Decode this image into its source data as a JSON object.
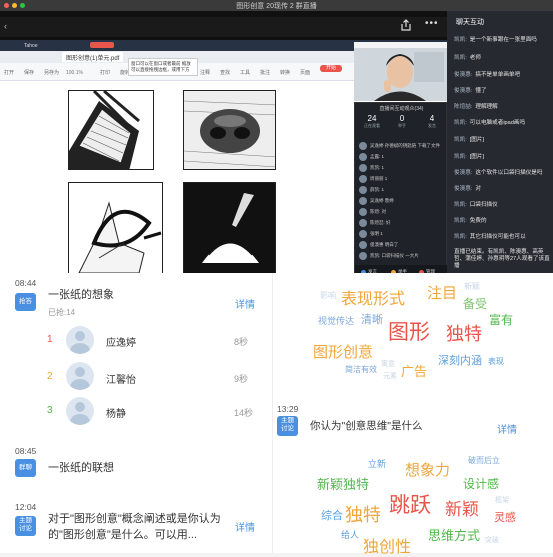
{
  "window": {
    "title": "图形创意 20现传 2 群直播"
  },
  "chat": {
    "title": "聊天互动",
    "messages": [
      {
        "name": "凯凯:",
        "text": "是一个新事跟在一张里面吗"
      },
      {
        "name": "凯凯:",
        "text": "老师"
      },
      {
        "name": "俊澳惠:",
        "text": "搞不是单单画单吧"
      },
      {
        "name": "俊澳惠:",
        "text": "懂了"
      },
      {
        "name": "陈煊喆:",
        "text": "理解理解"
      },
      {
        "name": "凯凯:",
        "text": "可以电脑或者ipad画吗"
      },
      {
        "name": "凯凯:",
        "text": "[图片]"
      },
      {
        "name": "凯凯:",
        "text": "[图片]"
      },
      {
        "name": "俊澳惠:",
        "text": "这个软件以口袋扫描仪是吗"
      },
      {
        "name": "俊澳惠:",
        "text": "对"
      },
      {
        "name": "凯凯:",
        "text": "口袋扫描仪"
      },
      {
        "name": "凯凯:",
        "text": "免费的"
      },
      {
        "name": "凯凯:",
        "text": "其它扫描仪可能也可以"
      },
      {
        "name": "",
        "text": "直播已结束。有凯凯、陈澳惠、高英哲、蒲佳婷、孙惠玥等27人观看了该直播"
      }
    ]
  },
  "shared_app": {
    "tab1": "Tahoe",
    "tab2": "图形创意(1)单元.pdf",
    "tooltip": "窗口可以在窗口或者最前 缩放可以直接拖拽边框，或用下方",
    "pill": "开始",
    "zoom": "100.1%",
    "ribbon": [
      "打开",
      "保存",
      "另存为",
      "打印",
      "旋转",
      "插入",
      "缩放",
      "注释",
      "查找",
      "工具",
      "批注",
      "转换",
      "页面"
    ]
  },
  "class_panel": {
    "title": "直播间互动观众(34)",
    "stats": [
      {
        "value": "24",
        "label": "正在观看"
      },
      {
        "value": "0",
        "label": "举手"
      },
      {
        "value": "4",
        "label": "发言"
      }
    ],
    "rows": [
      "吴逸婷 孙德斌的钥匙链 下载了文件",
      "孟露: 1",
      "凯凯: 1",
      "周丽丽 1",
      "薛凯: 1",
      "吴逸婷 鲁婷",
      "陈煊: 对",
      "陈煊喆: 好",
      "张明 1",
      "俊澳惠 明白了",
      "凯凯: 口袋扫描仪 一大片"
    ],
    "foot": [
      "发言",
      "举手",
      "管理"
    ]
  },
  "activities": [
    {
      "time": "08:44",
      "tag": "抢答",
      "title": "一张纸的想象",
      "detail": "详情",
      "sub": "已抢:14",
      "ranking": [
        {
          "rank": "1",
          "name": "应逸婷",
          "time": "8秒",
          "color": "#e8554a"
        },
        {
          "rank": "2",
          "name": "江馨怡",
          "time": "9秒",
          "color": "#f0a63a"
        },
        {
          "rank": "3",
          "name": "杨静",
          "time": "14秒",
          "color": "#52b84c"
        }
      ]
    },
    {
      "time": "08:45",
      "tag": "群聊",
      "title": "一张纸的联想"
    },
    {
      "time": "12:04",
      "tag": "主题\n讨论",
      "title": "对于\"图形创意\"概念阐述或是你认为的\"图形创意\"是什么。可以用...",
      "detail": "详情"
    }
  ],
  "discussion2": {
    "time": "13:29",
    "tag": "主题\n讨论",
    "title": "你认为\"创意思维\"是什么",
    "detail": "详情"
  },
  "cloud1": [
    {
      "t": "表现形式",
      "c": "#f0a63a"
    },
    {
      "t": "注目",
      "c": "#f0a63a"
    },
    {
      "t": "新颖",
      "c": "#c9d6e6"
    },
    {
      "t": "备受",
      "c": "#7cc36e"
    },
    {
      "t": "影响",
      "c": "#c9d6e6"
    },
    {
      "t": "视觉传达",
      "c": "#7aa7dc"
    },
    {
      "t": "清晰",
      "c": "#7aa7dc"
    },
    {
      "t": "图形",
      "c": "#e8554a"
    },
    {
      "t": "独特",
      "c": "#e8554a"
    },
    {
      "t": "富有",
      "c": "#52b84c"
    },
    {
      "t": "图形创意",
      "c": "#f0a63a"
    },
    {
      "t": "深刻内涵",
      "c": "#5aa0e0"
    },
    {
      "t": "表现",
      "c": "#5aa0e0"
    },
    {
      "t": "广告",
      "c": "#f0a63a"
    },
    {
      "t": "简洁有效",
      "c": "#7aa7dc"
    },
    {
      "t": "元素",
      "c": "#c9d6e6"
    },
    {
      "t": "寓意",
      "c": "#c9d6e6"
    }
  ],
  "cloud2": [
    {
      "t": "立新",
      "c": "#5aa0e0"
    },
    {
      "t": "破而后立",
      "c": "#7aa7dc"
    },
    {
      "t": "想象力",
      "c": "#f0a63a"
    },
    {
      "t": "新颖独特",
      "c": "#52b84c"
    },
    {
      "t": "设计感",
      "c": "#52b84c"
    },
    {
      "t": "跳跃",
      "c": "#e8554a"
    },
    {
      "t": "新颖",
      "c": "#e8554a"
    },
    {
      "t": "综合",
      "c": "#5aa0e0"
    },
    {
      "t": "独特",
      "c": "#f0a63a"
    },
    {
      "t": "灵感",
      "c": "#e8554a"
    },
    {
      "t": "框架",
      "c": "#c9d6e6"
    },
    {
      "t": "给人",
      "c": "#5aa0e0"
    },
    {
      "t": "思维方式",
      "c": "#52b84c"
    },
    {
      "t": "独创性",
      "c": "#f0a63a"
    },
    {
      "t": "突破",
      "c": "#c9d6e6"
    }
  ]
}
